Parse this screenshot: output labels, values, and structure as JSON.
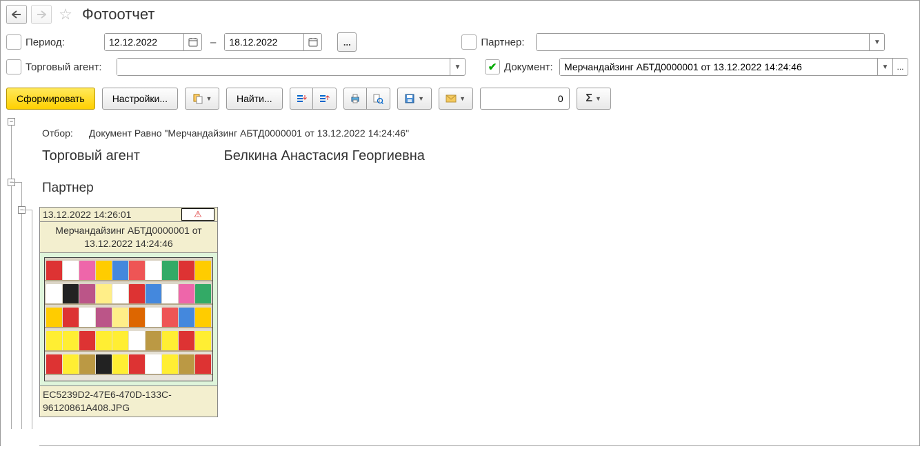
{
  "title": "Фотоотчет",
  "filters": {
    "period_label": "Период:",
    "date_from": "12.12.2022",
    "date_to": "18.12.2022",
    "agent_label": "Торговый агент:",
    "agent_value": "",
    "partner_label": "Партнер:",
    "partner_value": "",
    "document_label": "Документ:",
    "document_value": "Мерчандайзинг АБТД0000001 от 13.12.2022 14:24:46",
    "period_checked": false,
    "agent_checked": false,
    "partner_checked": false,
    "document_checked": true
  },
  "toolbar": {
    "generate": "Сформировать",
    "settings": "Настройки...",
    "find": "Найти...",
    "num_value": "0"
  },
  "report": {
    "filter_label": "Отбор:",
    "filter_text": "Документ Равно \"Мерчандайзинг АБТД0000001 от 13.12.2022 14:24:46\"",
    "agent_label": "Торговый агент",
    "agent_value": "Белкина Анастасия Георгиевна",
    "partner_label": "Партнер",
    "card": {
      "timestamp": "13.12.2022 14:26:01",
      "doc_text": "Мерчандайзинг АБТД0000001 от 13.12.2022 14:24:46",
      "filename": "EC5239D2-47E6-470D-133C-96120861A408.JPG"
    }
  }
}
